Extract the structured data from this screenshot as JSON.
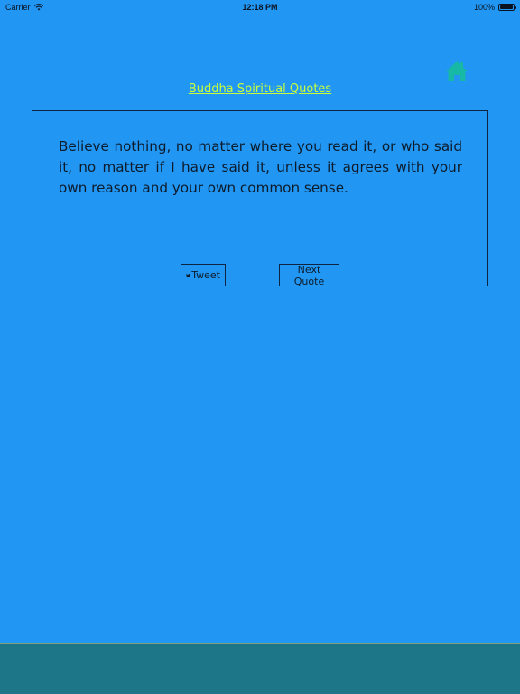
{
  "status_bar": {
    "carrier": "Carrier",
    "time": "12:18 PM",
    "battery": "100%",
    "battery_level": 1.0
  },
  "header": {
    "title": "Buddha Spiritual Quotes",
    "home_icon": "home-icon"
  },
  "quote": {
    "text": "Believe nothing, no matter where you read it, or who said it, no matter if I have said it, unless it agrees with your own reason and your own common sense."
  },
  "actions": {
    "tweet_label": "Tweet",
    "tweet_icon": "twitter-bird-icon",
    "next_label": "Next Quote"
  },
  "colors": {
    "background": "#2196f3",
    "title_link": "#c8ff3a",
    "home_icon": "#17b8a6",
    "bottom_bar": "#1d7588"
  }
}
